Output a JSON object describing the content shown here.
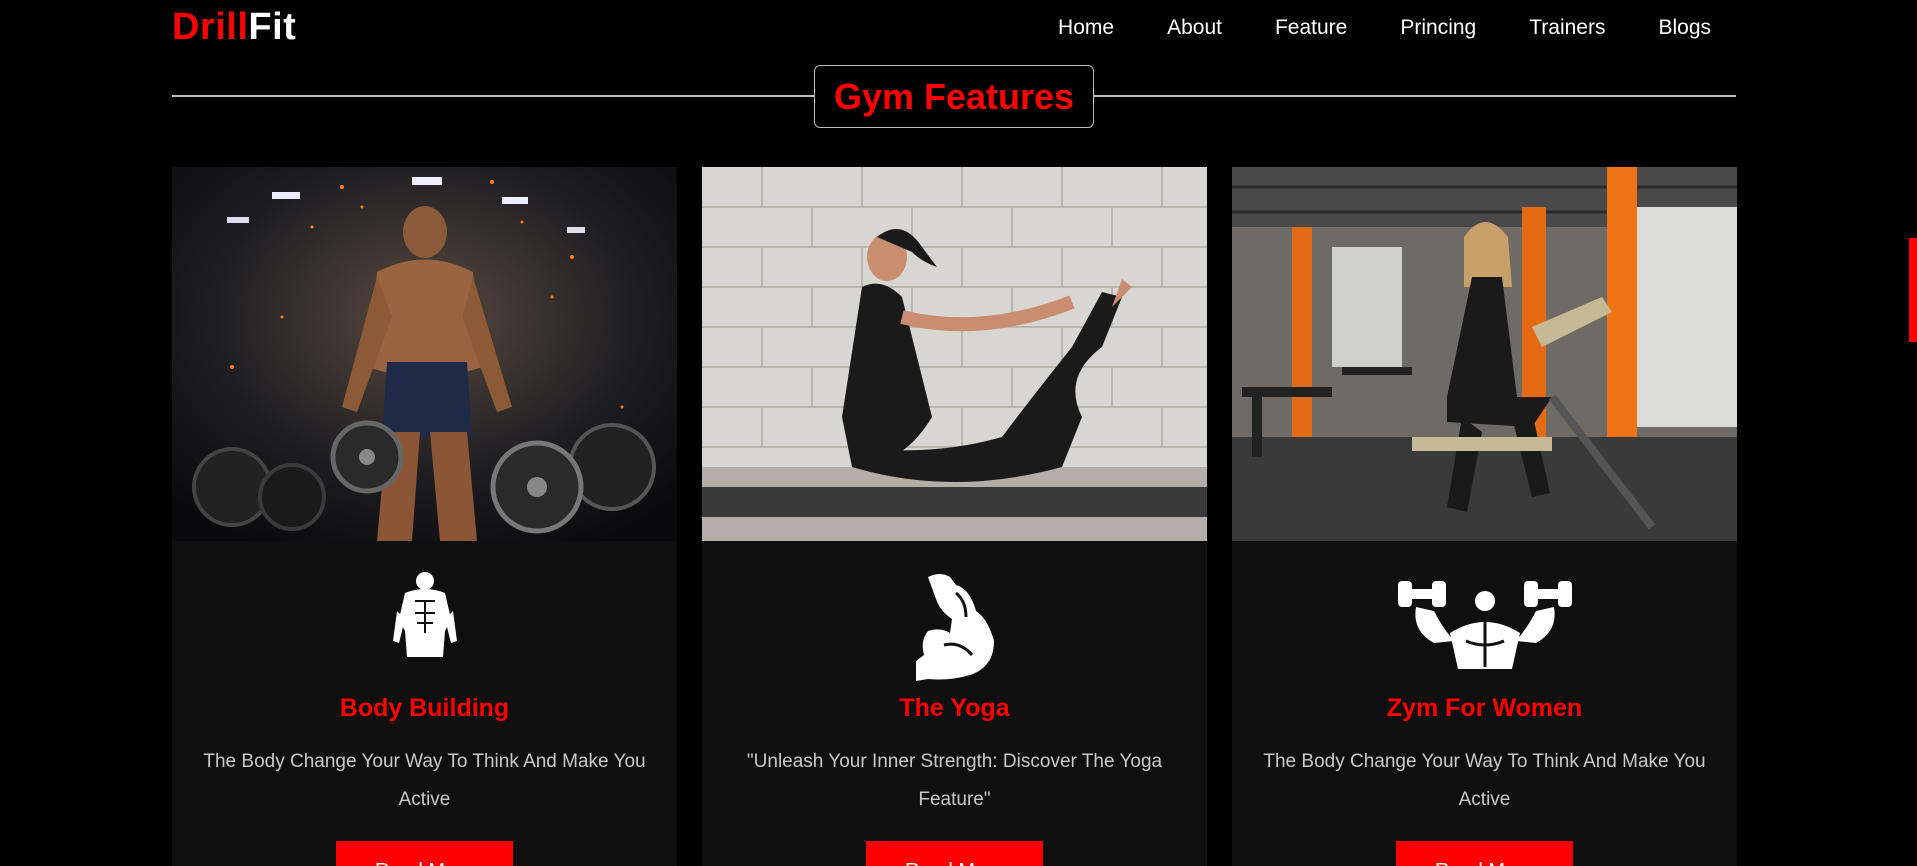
{
  "header": {
    "logo_part1": "Drill",
    "logo_part2": "Fit",
    "nav": [
      "Home",
      "About",
      "Feature",
      "Princing",
      "Trainers",
      "Blogs"
    ]
  },
  "section": {
    "title": "Gym Features"
  },
  "cards": [
    {
      "icon": "bodybuilder-icon",
      "title": "Body Building",
      "description": "The Body Change Your Way To Think And Make You Active",
      "button": "Read More"
    },
    {
      "icon": "flexed-arm-icon",
      "title": "The Yoga",
      "description": "\"Unleash Your Inner Strength: Discover The Yoga Feature\"",
      "button": "Read More"
    },
    {
      "icon": "dumbbell-muscle-icon",
      "title": "Zym For Women",
      "description": "The Body Change Your Way To Think And Make You Active",
      "button": "Read More"
    }
  ],
  "colors": {
    "accent": "#ff0000",
    "background": "#000000",
    "card_bg": "#0f0f0f",
    "text_muted": "#c9c9c9"
  }
}
